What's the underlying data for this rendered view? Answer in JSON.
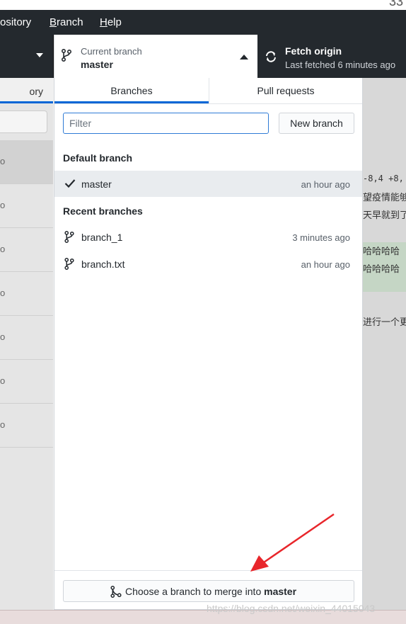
{
  "top": {
    "corner_number": "33"
  },
  "menubar": {
    "repository": "ository",
    "branch": "Branch",
    "branch_mnemonic": "B",
    "branch_rest": "ranch",
    "help_mnemonic": "H",
    "help_rest": "elp"
  },
  "toolbar": {
    "current_branch_label": "Current branch",
    "current_branch_value": "master",
    "fetch_title": "Fetch origin",
    "fetch_subtitle": "Last fetched 6 minutes ago"
  },
  "left_panel": {
    "tab_label": "ory",
    "row_glyph": "o"
  },
  "right_bg": {
    "diff_header": "-8,4 +8,",
    "line1": "望疫情能够",
    "line2": "天早就到了",
    "line3": "哈哈哈哈",
    "line4": "哈哈哈哈",
    "line5": "进行一个更"
  },
  "dropdown": {
    "tabs": [
      {
        "label": "Branches",
        "active": true
      },
      {
        "label": "Pull requests",
        "active": false
      }
    ],
    "filter_placeholder": "Filter",
    "new_branch_label": "New branch",
    "default_branch_heading": "Default branch",
    "default_branch": {
      "name": "master",
      "time": "an hour ago",
      "selected": true
    },
    "recent_heading": "Recent branches",
    "recent_branches": [
      {
        "name": "branch_1",
        "time": "3 minutes ago"
      },
      {
        "name": "branch.txt",
        "time": "an hour ago"
      }
    ],
    "merge_prefix": "Choose a branch to merge into ",
    "merge_target": "master"
  },
  "watermark": "https://blog.csdn.net/weixin_44015043",
  "colors": {
    "accent": "#0366d6",
    "toolbar_bg": "#24292e",
    "annotation_arrow": "#e8262b"
  }
}
